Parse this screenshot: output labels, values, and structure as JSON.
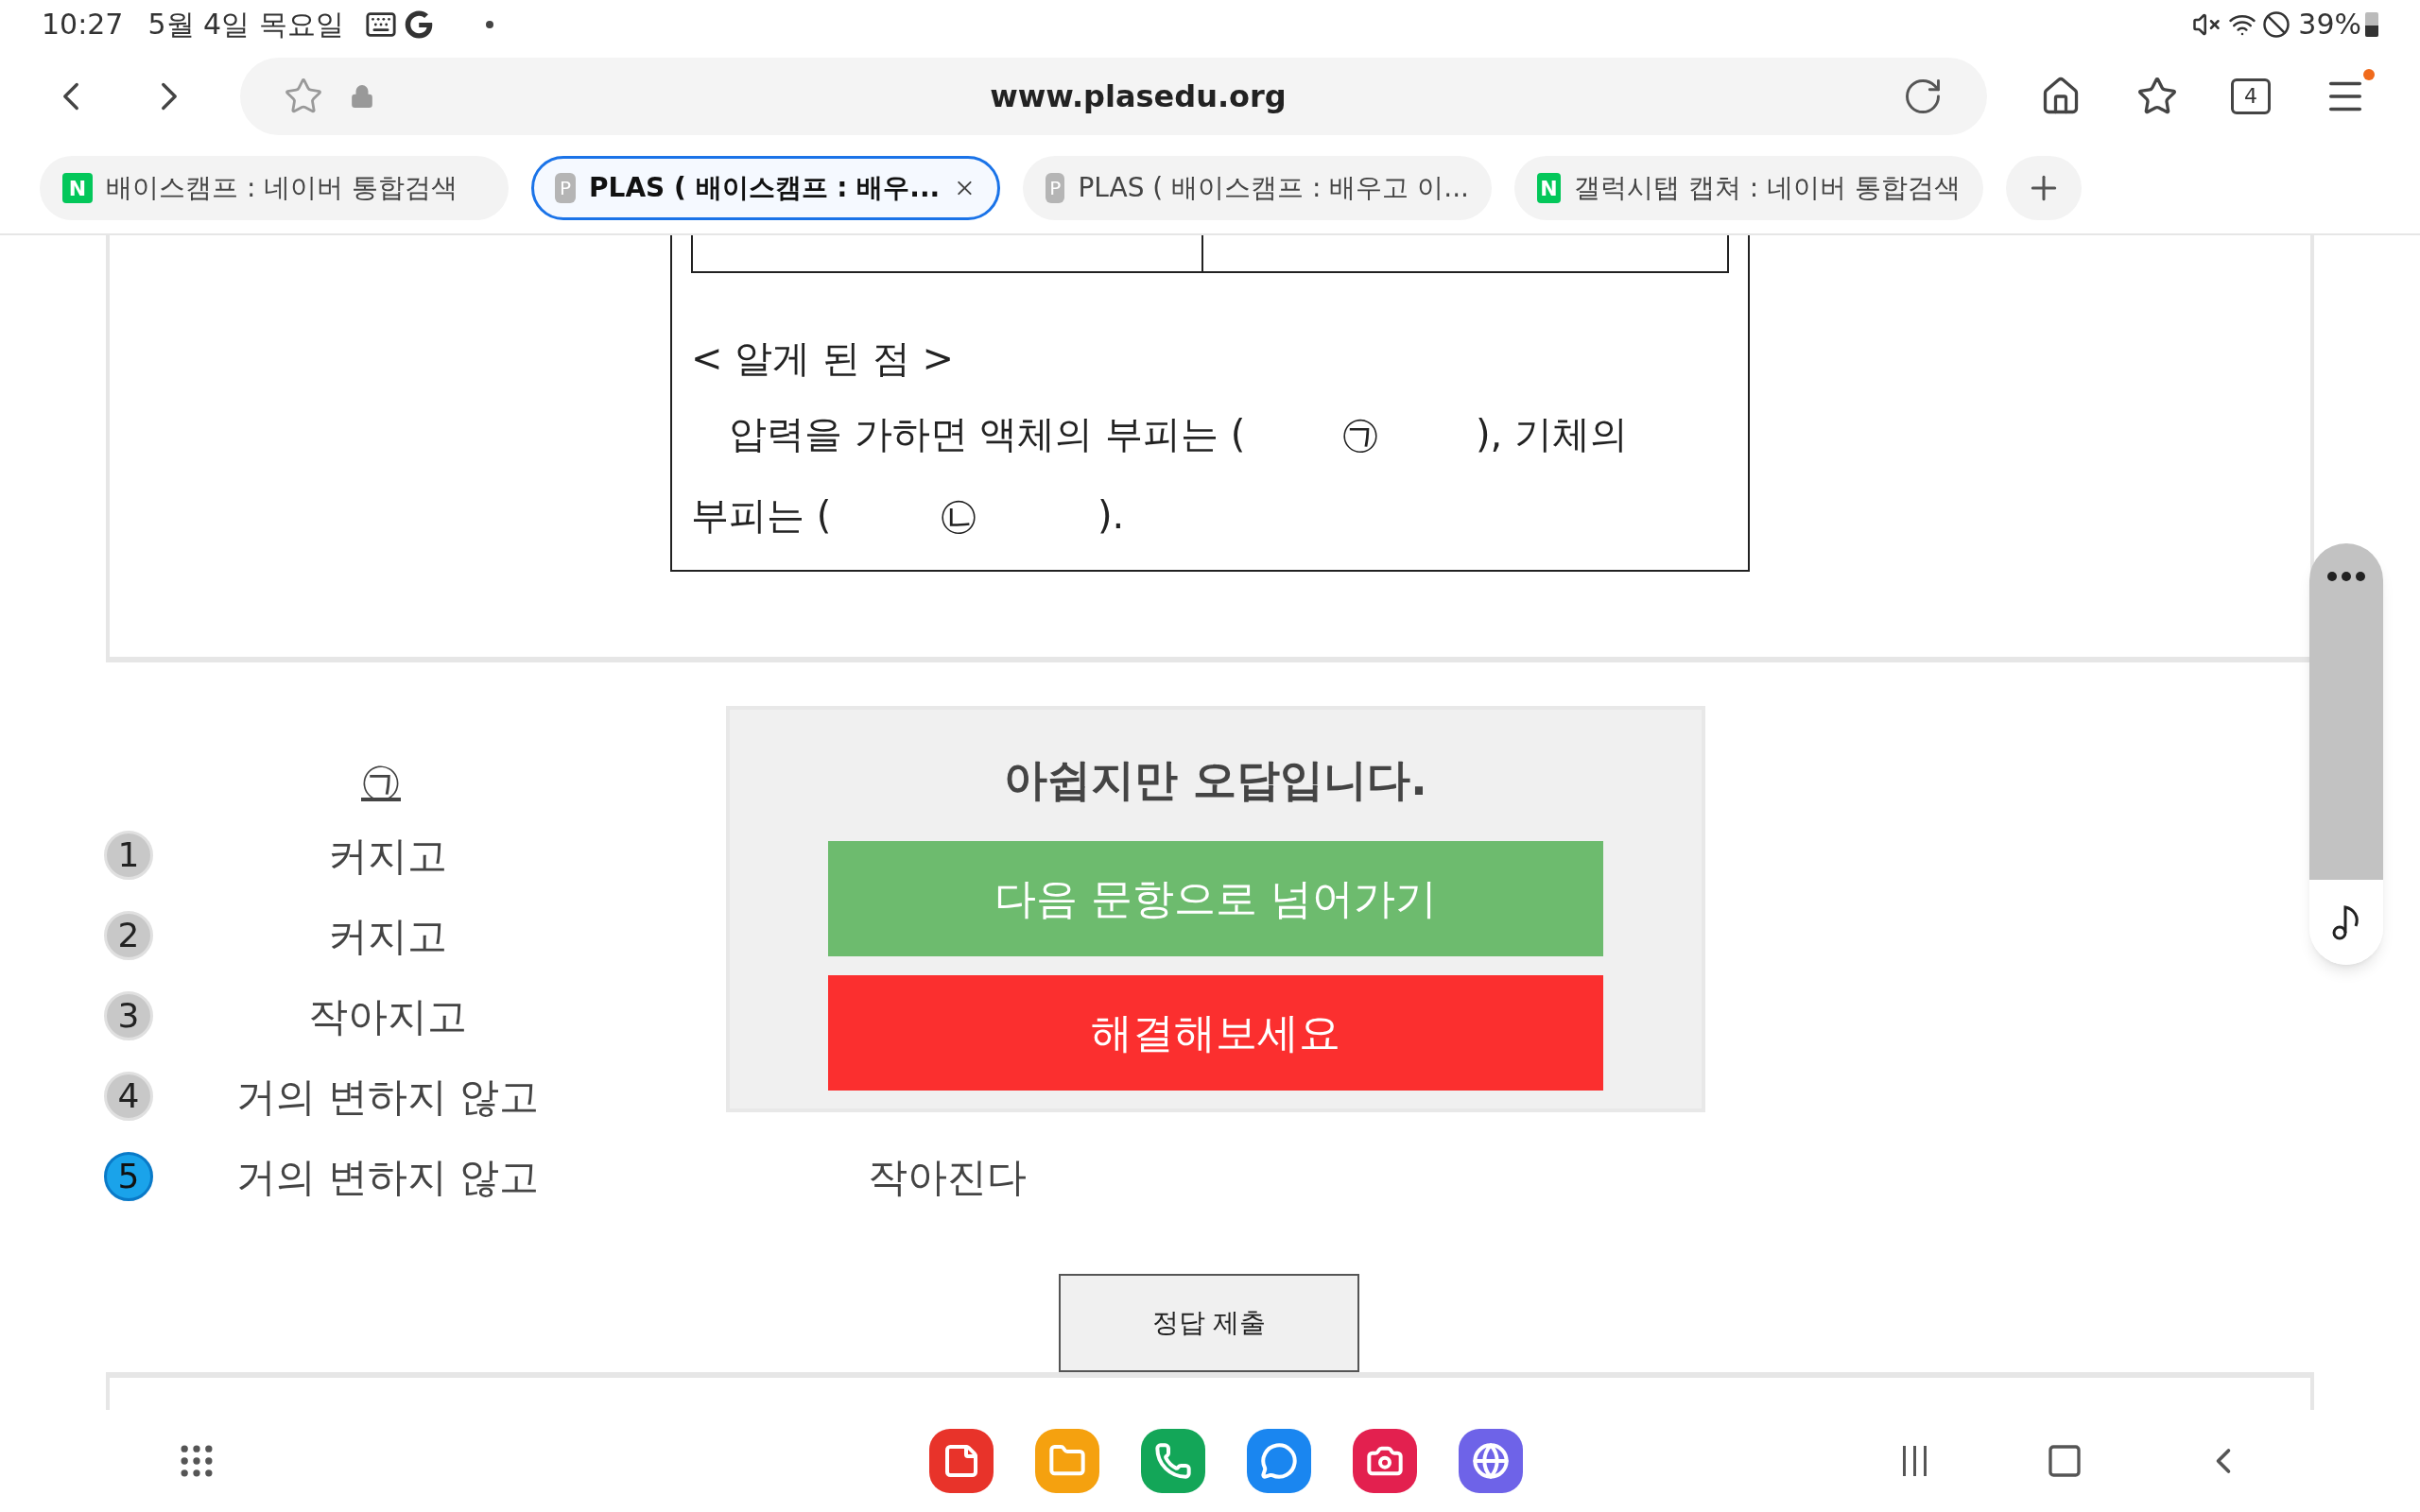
{
  "status_bar": {
    "time": "10:27",
    "date": "5월 4일 목요일",
    "battery": "39%"
  },
  "address_bar": {
    "url": "www.plasedu.org",
    "tab_count": "4",
    "menu_badge": true
  },
  "tabs": [
    {
      "favicon": "N",
      "kind": "naver",
      "label": "배이스캠프 : 네이버 통합검색",
      "selected": false
    },
    {
      "favicon": "P",
      "kind": "plas",
      "label": "PLAS ( 배이스캠프 : 배우...",
      "selected": true
    },
    {
      "favicon": "P",
      "kind": "plas",
      "label": "PLAS ( 배이스캠프 : 배우고 이...",
      "selected": false
    },
    {
      "favicon": "N",
      "kind": "naver",
      "label": "갤럭시탭 캡쳐 : 네이버 통합검색",
      "selected": false
    }
  ],
  "question_figure": {
    "heading": "< 알게 된 점 >",
    "line_1": "압력을 가하면 액체의 부피는 (        ㉠        ), 기체의",
    "line_2": "부피는 (         ㉡          )."
  },
  "answer_table": {
    "column_1": "㉠",
    "options": [
      {
        "number": "1",
        "a": "커지고",
        "selected": false
      },
      {
        "number": "2",
        "a": "커지고",
        "selected": false
      },
      {
        "number": "3",
        "a": "작아지고",
        "selected": false
      },
      {
        "number": "4",
        "a": "거의 변하지 않고",
        "selected": false
      },
      {
        "number": "5",
        "a": "거의 변하지 않고",
        "b": "작아진다",
        "selected": true
      }
    ]
  },
  "result_dialog": {
    "title": "아쉽지만 오답입니다.",
    "next_button": "다음 문항으로 넘어가기",
    "solve_button": "해결해보세요"
  },
  "submit_button": "정답 제출",
  "dock": [
    {
      "kind": "notes",
      "color": "#e8332a"
    },
    {
      "kind": "folder",
      "color": "#f5a10f"
    },
    {
      "kind": "phone",
      "color": "#13a658"
    },
    {
      "kind": "chat",
      "color": "#1a86f0"
    },
    {
      "kind": "camera",
      "color": "#e3204f"
    },
    {
      "kind": "browser",
      "color": "#6e63e8"
    }
  ]
}
